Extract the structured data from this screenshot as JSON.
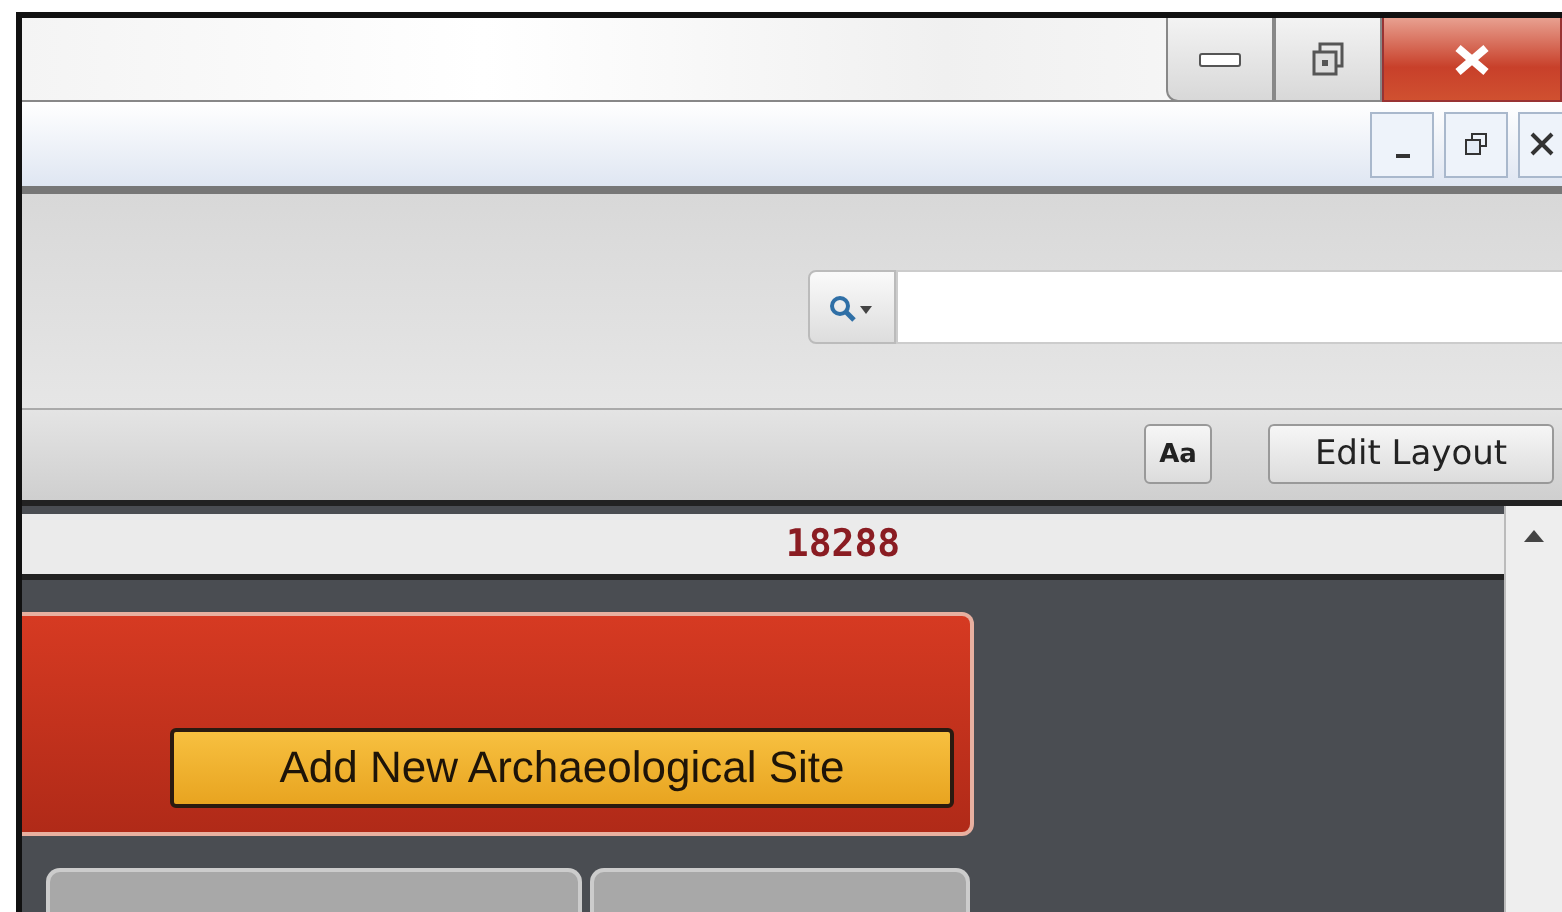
{
  "view_bar": {
    "buttons": [
      {
        "kind": "font",
        "label": "Aa"
      },
      {
        "kind": "text",
        "label": "Edit Layout"
      }
    ]
  },
  "record": {
    "header": "18288",
    "action_button": "Add New Archaeological Site",
    "cards": [
      {
        "kind": "card"
      },
      {
        "kind": "card"
      }
    ]
  }
}
